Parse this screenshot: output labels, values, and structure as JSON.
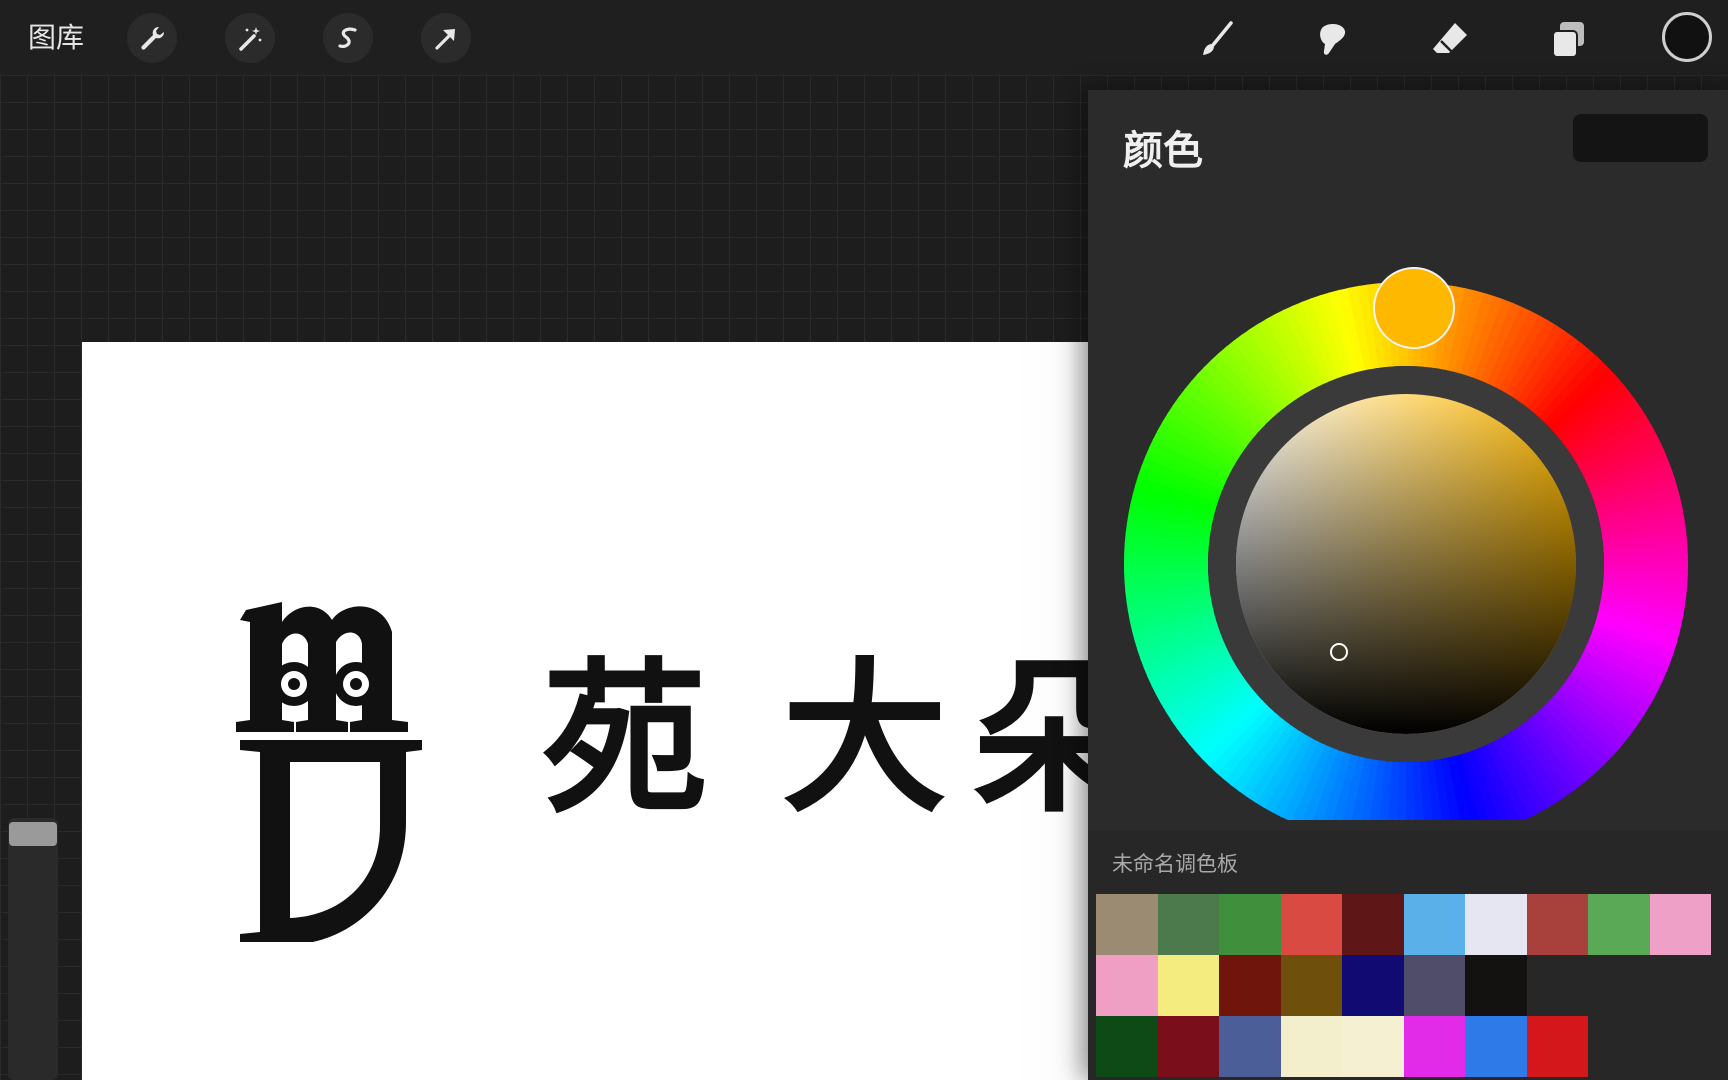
{
  "toolbar": {
    "gallery_label": "图库",
    "left_tools": [
      {
        "name": "wrench-icon",
        "label": "actions"
      },
      {
        "name": "magic-wand-icon",
        "label": "adjustments"
      },
      {
        "name": "selection-icon",
        "label": "selection"
      },
      {
        "name": "transform-arrow-icon",
        "label": "transform"
      }
    ],
    "right_tools": [
      "brush-icon",
      "smudge-icon",
      "eraser-icon",
      "layers-icon"
    ],
    "current_color": "#111111"
  },
  "canvas": {
    "text_chars": [
      "苑",
      "大",
      "朵"
    ],
    "background": "#ffffff"
  },
  "color_panel": {
    "title": "颜色",
    "current_color": "#141414",
    "hue_marker_color": "#ffb800",
    "palette_name": "未命名调色板",
    "palette_rows": [
      [
        "#9b8b73",
        "#4d7a4c",
        "#3f8f3c",
        "#d94a43",
        "#5e1616",
        "#5ab1ea",
        "#e6e6f2",
        "#a8403c",
        "#59a956",
        "#eea0c6"
      ],
      [
        "#f09fc4",
        "#f4ec7e",
        "#6f150c",
        "#6e4f0c",
        "#120a73",
        "#4f4d6a",
        "#141210"
      ],
      [
        "#0d4a16",
        "#7a0f1b",
        "#4b5e97",
        "#f3efcd",
        "#f6f0d3",
        "#e12be8",
        "#2d7ae8",
        "#d3171b"
      ]
    ]
  }
}
